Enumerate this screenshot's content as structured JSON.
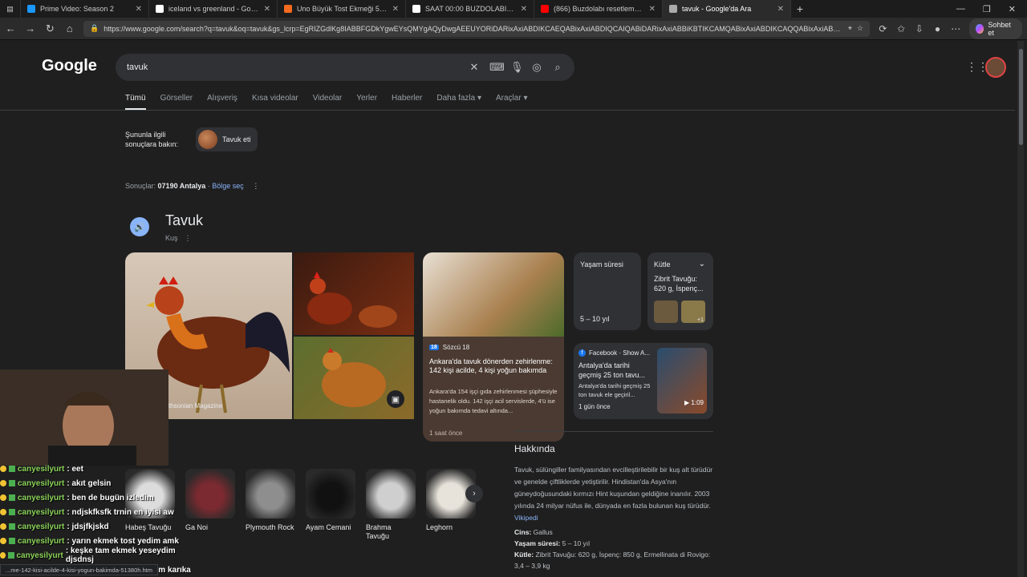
{
  "browser": {
    "tabs": [
      {
        "title": "Prime Video: Season 2",
        "color": "#1a98ff"
      },
      {
        "title": "iceland vs greenland - Google'da",
        "color": "#ffffff"
      },
      {
        "title": "Uno Büyük Tost Ekmeği 550 G - M",
        "color": "#f46b1f"
      },
      {
        "title": "SAAT 00:00 BUZDOLABI BAŞINDA",
        "color": "#ffffff"
      },
      {
        "title": "(866) Buzdolabı resetleme-Altus A",
        "color": "#ff0000"
      },
      {
        "title": "tavuk - Google'da Ara",
        "color": "#aaaaaa"
      }
    ],
    "url": "https://www.google.com/search?q=tavuk&oq=tavuk&gs_lcrp=EgRIZGdlKg8IABBFGDkYgwEYsQMYgAQyDwgAEEUYORiDARixAxiABDIKCAEQABixAxiABDIQCAIQABiDARixAxiABBiKBTIKCAMQABixAxiABDIKCAQQABixAxiABDI...",
    "copilot_label": "Sohbet et"
  },
  "google": {
    "logo": "Google",
    "query": "tavuk",
    "tabs": [
      "Tümü",
      "Görseller",
      "Alışveriş",
      "Kısa videolar",
      "Videolar",
      "Yerler",
      "Haberler",
      "Daha fazla ▾",
      "Araçlar ▾"
    ],
    "related_label": "Şununla ilgili sonuçlara bakın:",
    "related_chip": "Tavuk eti",
    "location_prefix": "Sonuçlar:",
    "location_value": "07190 Antalya",
    "location_link": "· Bölge seç"
  },
  "knowledge": {
    "title": "Tavuk",
    "subtitle": "Kuş",
    "image_caption": "thsonian Magazine",
    "news": {
      "source_badge": "18",
      "source": "Sözcü 18",
      "title": "Ankara'da tavuk dönerden zehirlenme: 142 kişi acilde, 4 kişi yoğun bakımda",
      "snippet": "Ankara'da 154 işçi gıda zehirlenmesi şüphesiyle hastanelik oldu. 142 işçi acil servislerde, 4'ü ise yoğun bakımda tedavi altında...",
      "time": "1 saat önce"
    },
    "lifespan": {
      "label": "Yaşam süresi",
      "value": "5 – 10 yıl"
    },
    "mass": {
      "label": "Kütle",
      "value": "Zibrit Tavuğu: 620 g, İspenç...",
      "more": "+1"
    },
    "facebook": {
      "source": "Facebook · Show A...",
      "title": "Antalya'da tarihi geçmiş 25 ton tavu...",
      "snippet": "Antalya'da tarihi geçmiş 25 ton tavuk ele geçiril...",
      "time": "1 gün önce",
      "duration": "▶ 1:09"
    },
    "about_title": "Hakkında",
    "about_text": "Tavuk, sülüngiller familyasından evcilleştirilebilir bir kuş alt türüdür ve genelde çiftliklerde yetiştirilir. Hindistan'da Asya'nın güneydoğusundaki kırmızı Hint kuşundan geldiğine inanılır. 2003 yılında 24 milyar nüfus ile, dünyada en fazla bulunan kuş türüdür.",
    "about_link": "Vikipedi",
    "facts": [
      {
        "k": "Cins:",
        "v": "Gallus"
      },
      {
        "k": "Yaşam süresi:",
        "v": "5 – 10 yıl"
      },
      {
        "k": "Kütle:",
        "v": "Zibrit Tavuğu: 620 g, İspenç: 850 g, Ermellinata di Rovigo: 3,4 – 3,9 kg"
      }
    ],
    "breeds": [
      {
        "name": "Habeş Tavuğu",
        "color": "#dcdcdc"
      },
      {
        "name": "Ga Noi",
        "color": "#7a2a30"
      },
      {
        "name": "Plymouth Rock",
        "color": "#8e8e8e"
      },
      {
        "name": "Ayam Cemani",
        "color": "#111111"
      },
      {
        "name": "Brahma Tavuğu",
        "color": "#cfcfcf"
      },
      {
        "name": "Leghorn",
        "color": "#e7e2da"
      }
    ]
  },
  "stream_chat": [
    {
      "user": "canyesilyurt",
      "msg": ": eet"
    },
    {
      "user": "canyesilyurt",
      "msg": ": akıt gelsin"
    },
    {
      "user": "canyesilyurt",
      "msg": ": ben de bugün izledim"
    },
    {
      "user": "canyesilyurt",
      "msg": ": ndjskfksfk trnin en iyisi aw"
    },
    {
      "user": "canyesilyurt",
      "msg": ": jdsjfkjskd"
    },
    {
      "user": "canyesilyurt",
      "msg": ": yarın ekmek tost yedim amk"
    },
    {
      "user": "canyesilyurt",
      "msg": ": keşke tam ekmek yeseydim djsdnsj"
    },
    {
      "user": "canyesilyurt",
      "msg": ": bugün tavuk pilav yedim karıka"
    }
  ],
  "status_url": "...me-142-kisi-acilde-4-kisi-yogun-bakimda-51380h.htm"
}
